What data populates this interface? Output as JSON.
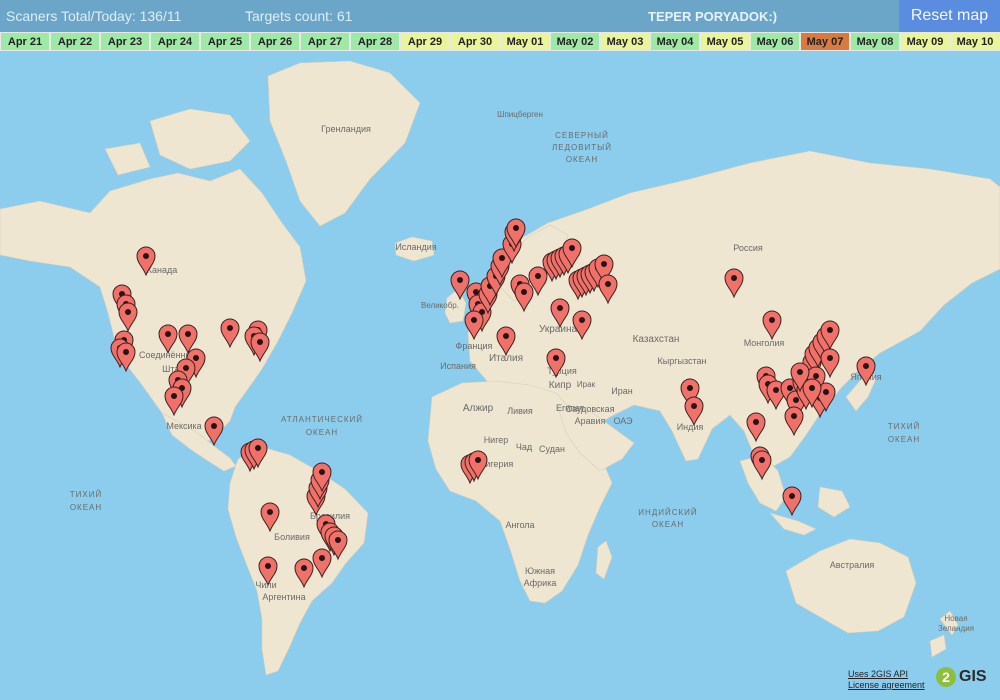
{
  "header": {
    "scaners_text": "Scaners Total/Today: 136/11",
    "targets_text": "Targets count: 61",
    "teper_text": "TEPER PORYADOK:)",
    "reset_label": "Reset map"
  },
  "dates": [
    {
      "label": "Apr 21",
      "color": "#9ee9a6"
    },
    {
      "label": "Apr 22",
      "color": "#9ee9a6"
    },
    {
      "label": "Apr 23",
      "color": "#9ee9a6"
    },
    {
      "label": "Apr 24",
      "color": "#9ee9a6"
    },
    {
      "label": "Apr 25",
      "color": "#9ee9a6"
    },
    {
      "label": "Apr 26",
      "color": "#9ee9a6"
    },
    {
      "label": "Apr 27",
      "color": "#9ee9a6"
    },
    {
      "label": "Apr 28",
      "color": "#9ee9a6"
    },
    {
      "label": "Apr 29",
      "color": "#e9f59a"
    },
    {
      "label": "Apr 30",
      "color": "#e9f59a"
    },
    {
      "label": "May 01",
      "color": "#e9f59a"
    },
    {
      "label": "May 02",
      "color": "#9ee9a6"
    },
    {
      "label": "May 03",
      "color": "#e9f59a"
    },
    {
      "label": "May 04",
      "color": "#9ee9a6"
    },
    {
      "label": "May 05",
      "color": "#e9f59a"
    },
    {
      "label": "May 06",
      "color": "#9ee9a6"
    },
    {
      "label": "May 07",
      "color": "#d97a42"
    },
    {
      "label": "May 08",
      "color": "#9ee9a6"
    },
    {
      "label": "May 09",
      "color": "#e9f59a"
    },
    {
      "label": "May 10",
      "color": "#e9f59a"
    }
  ],
  "map_labels": [
    "Гренландия",
    "Шпицберген",
    "СЕВЕРНЫЙ",
    "ЛЕДОВИТЫЙ",
    "ОКЕАН",
    "Исландия",
    "Россия",
    "Канада",
    "Великобр.",
    "Украина",
    "Франция",
    "Италия",
    "Испания",
    "Казахстан",
    "Монголия",
    "Кыргызстан",
    "Кипр",
    "Турция",
    "Иран",
    "Ирак",
    "Саудовская",
    "Аравия",
    "ОАЭ",
    "Индия",
    "Алжир",
    "Ливия",
    "Египет",
    "Нигер",
    "Чад",
    "Судан",
    "Нигерия",
    "Ангола",
    "Южная",
    "Африка",
    "АТЛАНТИЧЕСКИЙ",
    "ОКЕАН",
    "ТИХИЙ",
    "ОКЕАН",
    "ИНДИЙСКИЙ",
    "ОКЕАН",
    "ТИХИЙ",
    "ОКЕАН",
    "Мексика",
    "Соединённые",
    "Штаты",
    "Бразилия",
    "Боливия",
    "Чили",
    "Аргентина",
    "Япония",
    "Австралия",
    "Новая",
    "Зеландия"
  ],
  "attribution": {
    "api": "Uses 2GIS API",
    "license": "License agreement",
    "logo_text": "GIS",
    "logo_digit": "2"
  },
  "colors": {
    "ocean": "#8ccdee",
    "land": "#efe6d2",
    "marker": "#f0716a",
    "marker_stroke": "#3a1f1f"
  }
}
